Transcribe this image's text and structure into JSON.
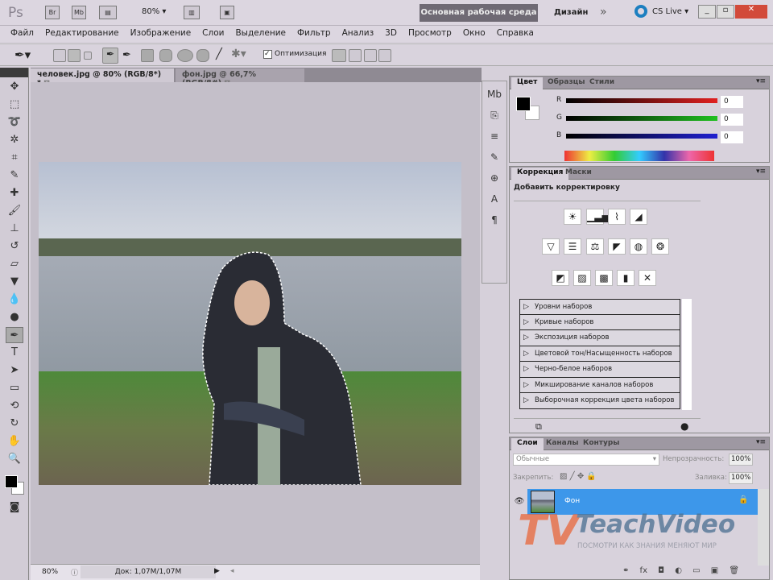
{
  "app": {
    "logo": "Ps",
    "bridge": "Br",
    "minibridge": "Mb",
    "zoom": "80%",
    "workspace_active": "Основная рабочая среда",
    "workspace_alt": "Дизайн",
    "more": "»",
    "cslive": "CS Live"
  },
  "menu": [
    "Файл",
    "Редактирование",
    "Изображение",
    "Слои",
    "Выделение",
    "Фильтр",
    "Анализ",
    "3D",
    "Просмотр",
    "Окно",
    "Справка"
  ],
  "options": {
    "optimize_label": "Оптимизация",
    "optimize_checked": true
  },
  "tabs": [
    {
      "label": "человек.jpg @ 80% (RGB/8*) *",
      "active": true
    },
    {
      "label": "фон.jpg @ 66,7% (RGB/8#)",
      "active": false
    }
  ],
  "status": {
    "zoom": "80%",
    "doc": "Док: 1,07M/1,07M"
  },
  "color_panel": {
    "tabs": [
      "Цвет",
      "Образцы",
      "Стили"
    ],
    "channels": [
      {
        "label": "R",
        "value": "0",
        "color": "#e02020"
      },
      {
        "label": "G",
        "value": "0",
        "color": "#20c020"
      },
      {
        "label": "B",
        "value": "0",
        "color": "#2020d0"
      }
    ]
  },
  "corrections": {
    "tabs": [
      "Коррекция",
      "Маски"
    ],
    "title": "Добавить корректировку",
    "presets": [
      "Уровни наборов",
      "Кривые наборов",
      "Экспозиция наборов",
      "Цветовой тон/Насыщенность наборов",
      "Черно-белое наборов",
      "Микширование каналов наборов",
      "Выборочная коррекция цвета наборов"
    ]
  },
  "layers": {
    "tabs": [
      "Слои",
      "Каналы",
      "Контуры"
    ],
    "blend_mode": "Обычные",
    "opacity_label": "Непрозрачность:",
    "opacity": "100%",
    "lock_label": "Закрепить:",
    "fill_label": "Заливка:",
    "fill": "100%",
    "items": [
      {
        "name": "Фон",
        "selected": true
      }
    ]
  },
  "watermark": {
    "brand": "TeachVideo",
    "slogan": "ПОСМОТРИ КАК ЗНАНИЯ МЕНЯЮТ МИР"
  }
}
